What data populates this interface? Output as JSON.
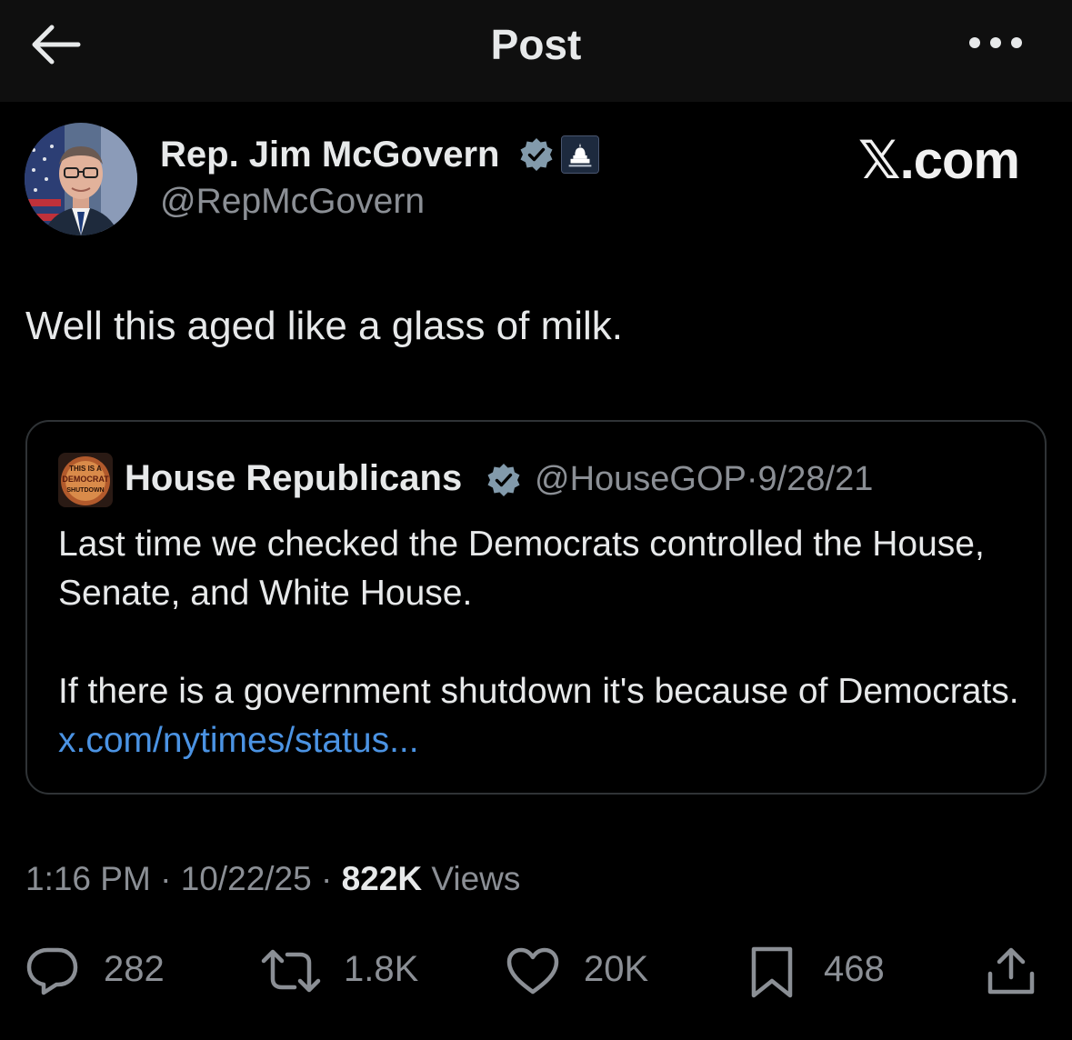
{
  "header": {
    "title": "Post",
    "back_icon": "arrow-left-icon",
    "more_icon": "more-horizontal-icon"
  },
  "author": {
    "display_name": "Rep. Jim McGovern",
    "handle": "@RepMcGovern",
    "verified_icon": "verified-badge-icon",
    "affiliation_badge_icon": "capitol-dome-icon"
  },
  "site_mark": "𝕏.com",
  "post": {
    "text": "Well this aged like a glass of milk."
  },
  "quoted_post": {
    "avatar_text": [
      "THIS IS A",
      "DEMOCRAT",
      "SHUTDOWN"
    ],
    "display_name": "House Republicans",
    "handle": "@HouseGOP",
    "separator": "·",
    "date": "9/28/21",
    "paragraph_1": "Last time we checked the Democrats controlled the House, Senate, and White House.",
    "paragraph_2_text": "If there is a government shutdown it's because of Democrats. ",
    "link_text": "x.com/nytimes/status..."
  },
  "meta": {
    "time": "1:16 PM",
    "sep1": " · ",
    "date": "10/22/25",
    "sep2": " · ",
    "views_count": "822K",
    "views_label": " Views"
  },
  "actions": {
    "replies": "282",
    "reposts": "1.8K",
    "likes": "20K",
    "bookmarks": "468"
  },
  "colors": {
    "background": "#000000",
    "header_background": "#0f0f0f",
    "text_primary": "#e7e9ea",
    "text_secondary": "#8b8f95",
    "link": "#4b93e3",
    "card_border": "#2f3336"
  }
}
